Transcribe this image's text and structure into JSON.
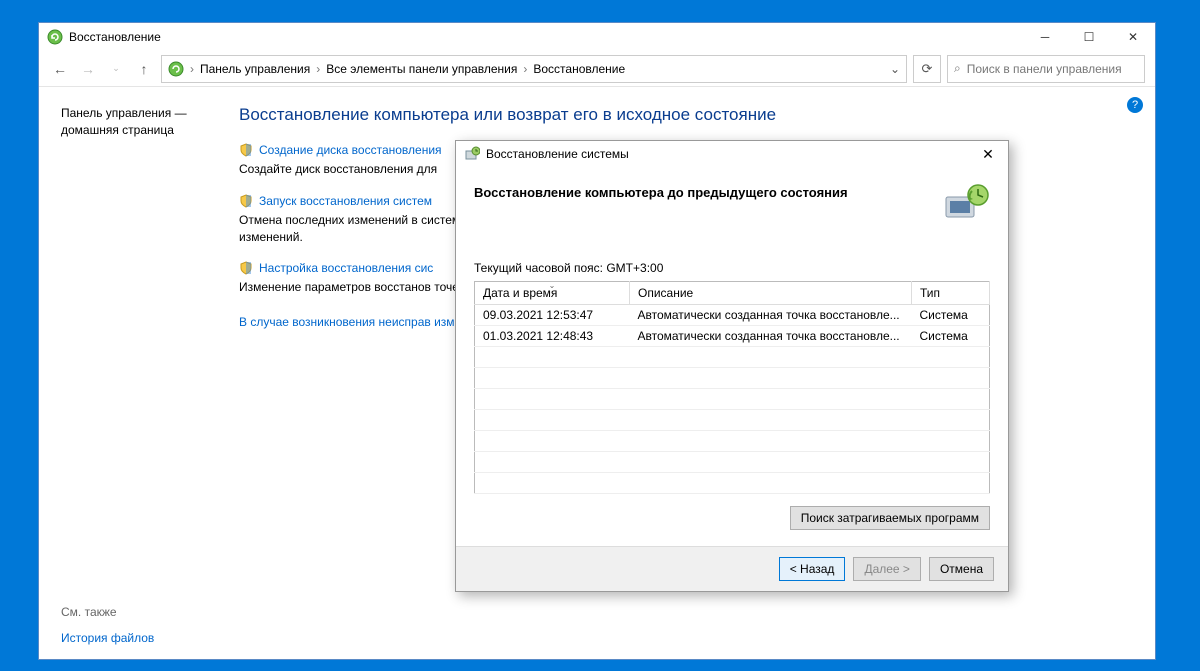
{
  "window": {
    "title": "Восстановление"
  },
  "breadcrumb": {
    "part1": "Панель управления",
    "part2": "Все элементы панели управления",
    "part3": "Восстановление"
  },
  "search": {
    "placeholder": "Поиск в панели управления"
  },
  "sidebar": {
    "cp_home_line1": "Панель управления —",
    "cp_home_line2": "домашняя страница"
  },
  "main": {
    "heading": "Восстановление компьютера или возврат его в исходное состояние",
    "link1": "Создание диска восстановления",
    "desc1": "Создайте диск восстановления для",
    "link2": "Запуск восстановления систем",
    "desc2": "Отмена последних изменений в системе, такие как документы, изображения, музыка, остаются без изменений.",
    "link3": "Настройка восстановления сис",
    "desc3": "Изменение параметров восстанов точек восстановления.",
    "trouble": "В случае возникновения неисправ изменить их."
  },
  "footer": {
    "also": "См. также",
    "history": "История файлов"
  },
  "dialog": {
    "title": "Восстановление системы",
    "heading": "Восстановление компьютера до предыдущего состояния",
    "timezone": "Текущий часовой пояс: GMT+3:00",
    "columns": {
      "datetime": "Дата и время",
      "description": "Описание",
      "type": "Тип"
    },
    "rows": [
      {
        "dt": "09.03.2021 12:53:47",
        "desc": "Автоматически созданная точка восстановле...",
        "type": "Система"
      },
      {
        "dt": "01.03.2021 12:48:43",
        "desc": "Автоматически созданная точка восстановле...",
        "type": "Система"
      }
    ],
    "scan_btn": "Поиск затрагиваемых программ",
    "back": "< Назад",
    "next": "Далее >",
    "cancel": "Отмена"
  }
}
